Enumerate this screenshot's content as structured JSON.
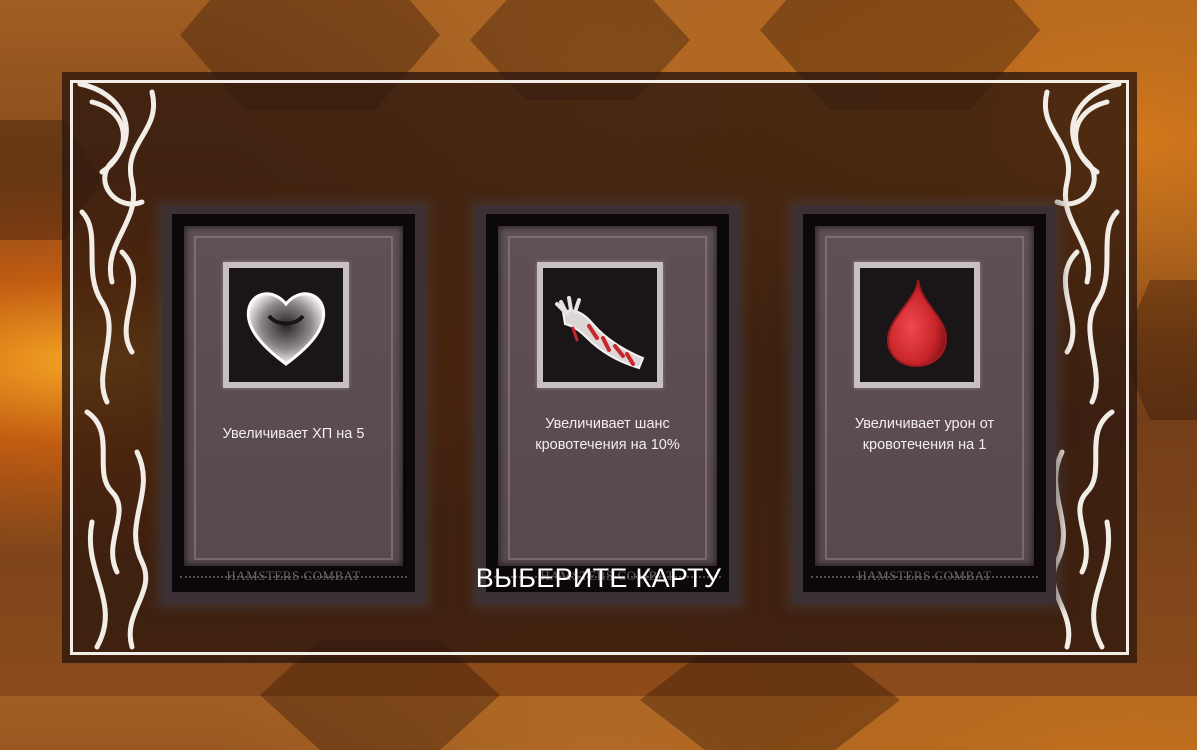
{
  "screen": {
    "prompt": "ВЫБЕРИТЕ КАРТУ"
  },
  "cards": [
    {
      "icon": "heart-icon",
      "text": "Увеличивает ХП на 5",
      "footer": "HAMSTERS COMBAT"
    },
    {
      "icon": "bloody-arm-icon",
      "text": "Увеличивает шанс кровотечения на 10%",
      "footer": "HAMSTERS COMBAT"
    },
    {
      "icon": "blood-drop-icon",
      "text": "Увеличивает урон от кровотечения на 1",
      "footer": "HAMSTERS COMBAT"
    }
  ],
  "colors": {
    "overlay": "#2e180e",
    "frame": "#f2ede6",
    "card_face": "#5e5054",
    "blood": "#c8262b"
  }
}
